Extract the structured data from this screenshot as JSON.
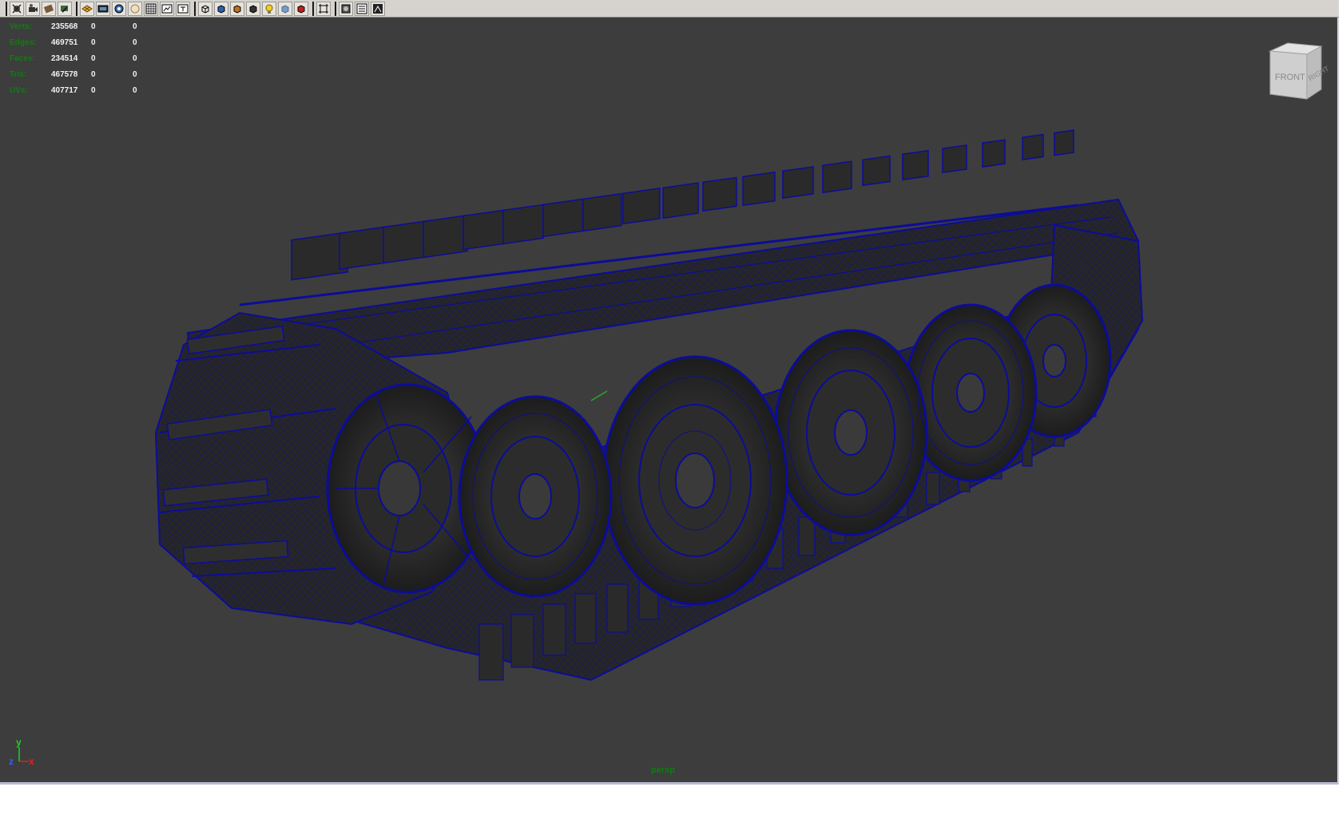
{
  "toolbar": {
    "buttons": [
      {
        "icon": "camera-attributes-icon"
      },
      {
        "icon": "camera-tools-icon"
      },
      {
        "icon": "bookmark-icon"
      },
      {
        "icon": "image-plane-icon"
      },
      {
        "icon": "grid-icon"
      },
      {
        "icon": "film-gate-icon"
      },
      {
        "icon": "resolution-gate-icon"
      },
      {
        "icon": "gate-mask-icon"
      },
      {
        "icon": "field-chart-icon"
      },
      {
        "icon": "safe-action-icon"
      },
      {
        "icon": "safe-title-icon"
      },
      {
        "icon": "wireframe-icon"
      },
      {
        "icon": "smooth-shade-icon"
      },
      {
        "icon": "textured-icon"
      },
      {
        "icon": "use-all-lights-icon"
      },
      {
        "icon": "shadows-icon"
      },
      {
        "icon": "default-light-icon"
      },
      {
        "icon": "x-ray-icon"
      },
      {
        "icon": "isolate-select-icon"
      },
      {
        "icon": "xray-joints-icon"
      },
      {
        "icon": "hud-icon"
      },
      {
        "icon": "ambient-occlusion-icon"
      },
      {
        "icon": "anti-alias-icon"
      }
    ]
  },
  "hud": {
    "rows": [
      {
        "label": "Verts:",
        "v1": "235568",
        "v2": "0",
        "v3": "0"
      },
      {
        "label": "Edges:",
        "v1": "469751",
        "v2": "0",
        "v3": "0"
      },
      {
        "label": "Faces:",
        "v1": "234514",
        "v2": "0",
        "v3": "0"
      },
      {
        "label": "Tris:",
        "v1": "467578",
        "v2": "0",
        "v3": "0"
      },
      {
        "label": "UVs:",
        "v1": "407717",
        "v2": "0",
        "v3": "0"
      }
    ]
  },
  "viewcube": {
    "front": "FRONT",
    "right": "RIGHT"
  },
  "axis": {
    "y": "y",
    "z": "z",
    "x": "x",
    "colors": {
      "x": "#e02020",
      "y": "#20d020",
      "z": "#3060ff"
    }
  },
  "camera_label": "persp",
  "colors": {
    "viewport_bg": "#3d3d3d",
    "wireframe": "#0c0c9a",
    "hud_label": "#137a13"
  }
}
